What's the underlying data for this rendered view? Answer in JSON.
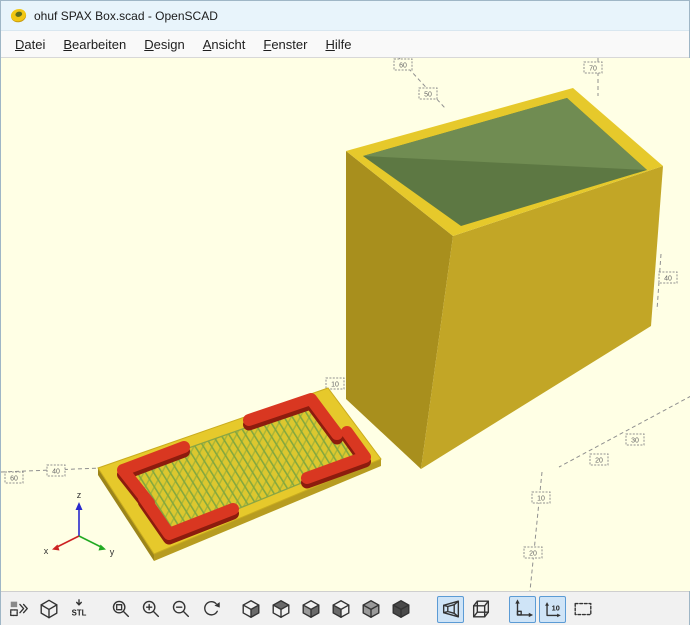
{
  "window": {
    "title": "ohuf SPAX Box.scad - OpenSCAD",
    "app_icon": "openscad-logo"
  },
  "menubar": {
    "items": [
      {
        "label": "Datei"
      },
      {
        "label": "Bearbeiten"
      },
      {
        "label": "Design"
      },
      {
        "label": "Ansicht"
      },
      {
        "label": "Fenster"
      },
      {
        "label": "Hilfe"
      }
    ]
  },
  "viewport": {
    "background_color": "#ffffe5",
    "axis_labels": {
      "x": "x",
      "y": "y",
      "z": "z"
    },
    "scale_markers": [
      "60",
      "40",
      "60",
      "50",
      "70",
      "40",
      "30",
      "20",
      "10",
      "20",
      "10"
    ],
    "model": {
      "body_color": "#e6c92b",
      "body_shade_left": "#a88f1d",
      "body_shade_right": "#c2a626",
      "interior_color": "#5d7843",
      "interior_light": "#708c52",
      "lid_color": "#e6c92b",
      "infill_color": "#84a83e",
      "bracket_color": "#d93721",
      "bracket_shade": "#8c1c0e"
    }
  },
  "toolbar": {
    "stl_label": "STL",
    "scale_label": "10",
    "accent_color": "#5b9bd5",
    "items": [
      {
        "name": "toolbar-overflow",
        "active": false
      },
      {
        "name": "show-edges",
        "active": false
      },
      {
        "name": "export-stl",
        "active": false
      },
      {
        "name": "zoom-all",
        "active": false
      },
      {
        "name": "zoom-in",
        "active": false
      },
      {
        "name": "zoom-out",
        "active": false
      },
      {
        "name": "reset-view",
        "active": false
      },
      {
        "name": "view-right",
        "active": false
      },
      {
        "name": "view-top",
        "active": false
      },
      {
        "name": "view-bottom",
        "active": false
      },
      {
        "name": "view-left",
        "active": false
      },
      {
        "name": "view-front",
        "active": false
      },
      {
        "name": "view-back",
        "active": false
      },
      {
        "name": "perspective-view",
        "active": true
      },
      {
        "name": "orthogonal-view",
        "active": false
      },
      {
        "name": "show-axes",
        "active": true
      },
      {
        "name": "show-scale-markers",
        "active": true
      },
      {
        "name": "view-all",
        "active": false
      }
    ]
  }
}
